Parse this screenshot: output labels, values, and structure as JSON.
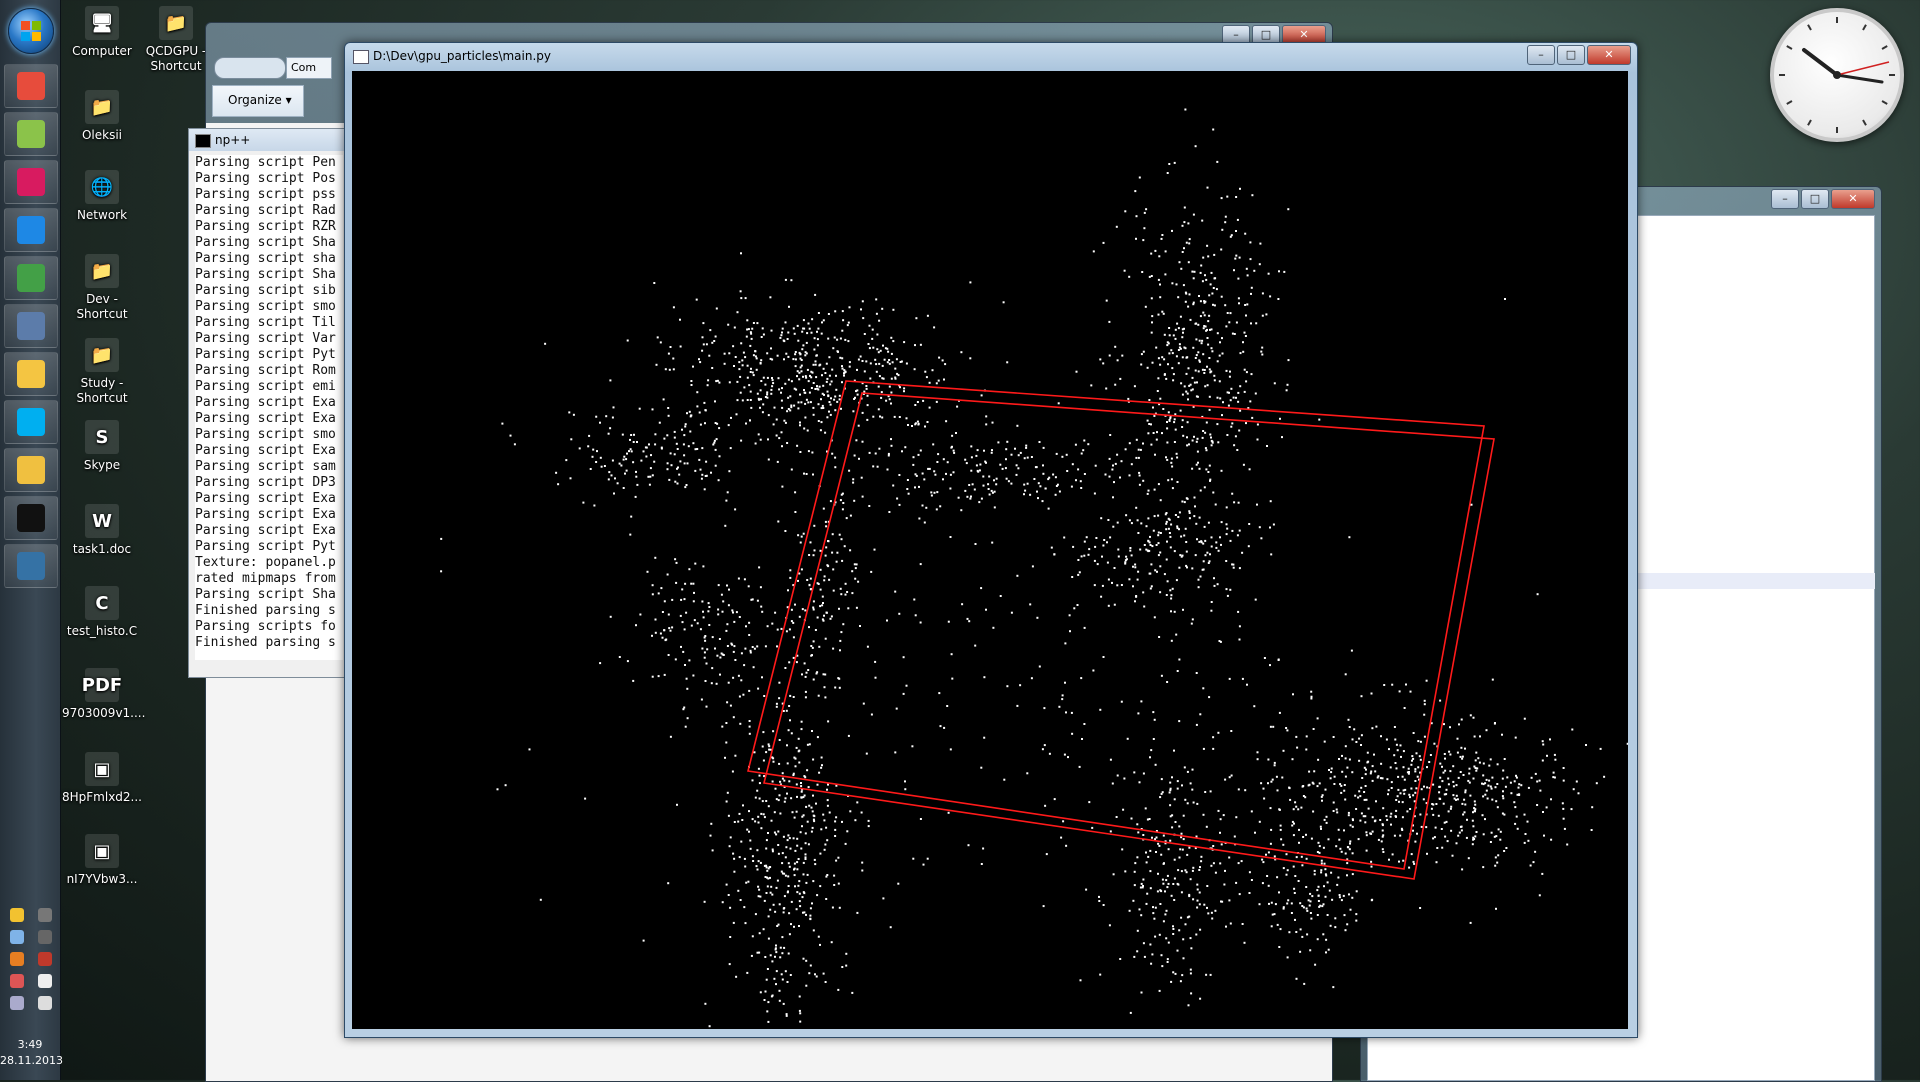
{
  "taskbar": {
    "start_label": "Start",
    "pinned": [
      {
        "name": "chrome",
        "color": "#e74c3c"
      },
      {
        "name": "finance-app",
        "color": "#8bc34a"
      },
      {
        "name": "debian",
        "color": "#d81b60"
      },
      {
        "name": "google-earth",
        "color": "#1e88e5"
      },
      {
        "name": "utorrent",
        "color": "#43a047"
      },
      {
        "name": "virtualbox",
        "color": "#5c7caa"
      },
      {
        "name": "folder",
        "color": "#f4c542"
      },
      {
        "name": "skype",
        "color": "#00aff0"
      },
      {
        "name": "explorer",
        "color": "#f0c040"
      },
      {
        "name": "cmd",
        "color": "#111111"
      },
      {
        "name": "python",
        "color": "#3572a5"
      }
    ],
    "time": "3:49",
    "date": "28.11.2013"
  },
  "desktop_icons": [
    {
      "label": "Computer",
      "glyph": "🖥"
    },
    {
      "label": "QCDGPU - Shortcut",
      "glyph": "📁"
    },
    {
      "label": "Oleksii",
      "glyph": "📁"
    },
    {
      "label": "Network",
      "glyph": "🌐"
    },
    {
      "label": "Dev - Shortcut",
      "glyph": "📁"
    },
    {
      "label": "Study - Shortcut",
      "glyph": "📁"
    },
    {
      "label": "Skype",
      "glyph": "S"
    },
    {
      "label": "task1.doc",
      "glyph": "W"
    },
    {
      "label": "test_histo.C",
      "glyph": "C"
    },
    {
      "label": "9703009v1....",
      "glyph": "PDF"
    },
    {
      "label": "8HpFmlxd2...",
      "glyph": "▣"
    },
    {
      "label": "nI7YVbw3...",
      "glyph": "▣"
    }
  ],
  "explorer": {
    "organize_label": "Organize ▾",
    "address": "Com"
  },
  "console": {
    "title": "np++",
    "lines": [
      "Parsing script Pen",
      "Parsing script Pos",
      "Parsing script pss",
      "Parsing script Rad",
      "Parsing script RZR",
      "Parsing script Sha",
      "Parsing script sha",
      "Parsing script Sha",
      "Parsing script sib",
      "Parsing script smo",
      "Parsing script Til",
      "Parsing script Var",
      "Parsing script Pyt",
      "Parsing script Rom",
      "Parsing script emi",
      "Parsing script Exa",
      "Parsing script Exa",
      "Parsing script smo",
      "Parsing script Exa",
      "Parsing script sam",
      "Parsing script DP3",
      "Parsing script Exa",
      "Parsing script Exa",
      "Parsing script Exa",
      "Parsing script Pyt",
      "Texture: popanel.p",
      "rated mipmaps from",
      "Parsing script Sha",
      "Finished parsing s",
      "Parsing scripts fo",
      "Finished parsing s"
    ]
  },
  "main_window": {
    "title": "D:\\Dev\\gpu_particles\\main.py",
    "min": "–",
    "max": "□",
    "close": "✕"
  },
  "colors": {
    "box": "#ff1a1a",
    "particles": "#ffffff"
  }
}
